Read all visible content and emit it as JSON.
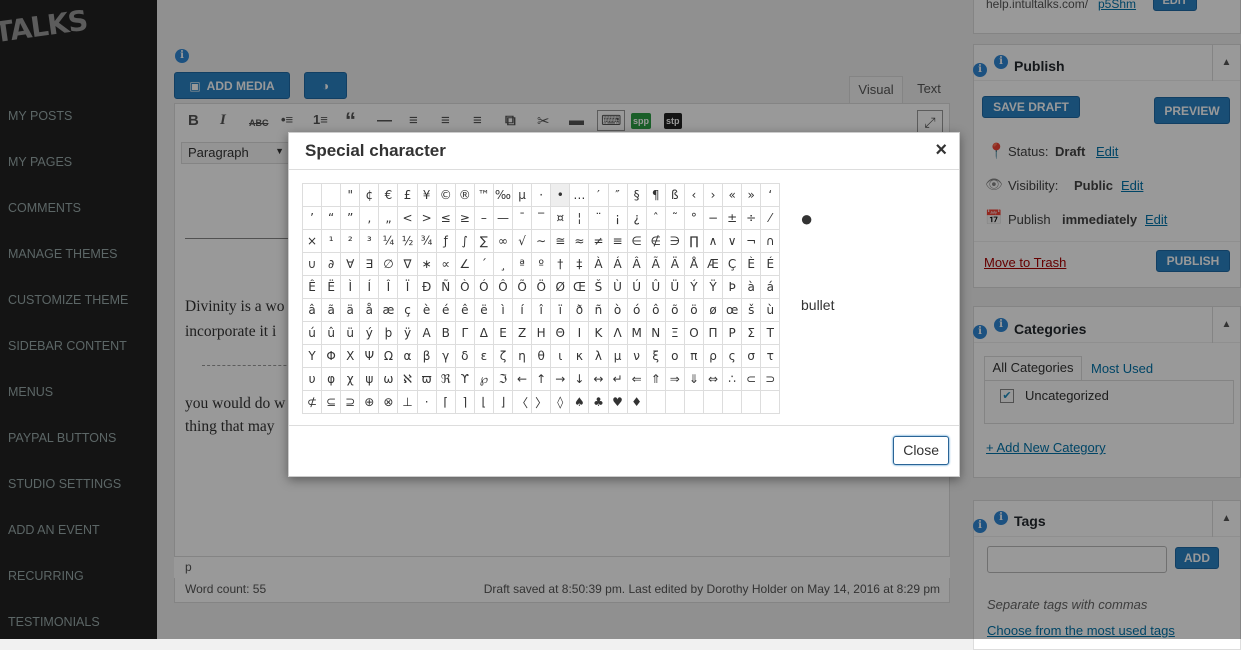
{
  "sidebar": {
    "logo": "TALKS",
    "items": [
      "MY POSTS",
      "MY PAGES",
      "COMMENTS",
      "MANAGE THEMES",
      "CUSTOMIZE THEME",
      "SIDEBAR CONTENT",
      "MENUS",
      "PAYPAL BUTTONS",
      "STUDIO SETTINGS",
      "ADD AN EVENT",
      "RECURRING",
      "TESTIMONIALS"
    ]
  },
  "editor": {
    "add_media": "ADD MEDIA",
    "tab_visual": "Visual",
    "tab_text": "Text",
    "format_select": "Paragraph",
    "toolbar": [
      "B",
      "I",
      "ABC",
      "•≡",
      "1≡",
      "“",
      "—",
      "≡",
      "≡",
      "≡",
      "⧉",
      "✂",
      "▬",
      "⌨",
      "spp",
      "stp"
    ],
    "content_line1": "Divinity is a wo",
    "content_line2": "incorporate it i",
    "content_line3": "you would do w",
    "content_line4": "thing that may",
    "path": "p",
    "word_count": "Word count: 55",
    "draft_status": "Draft saved at 8:50:39 pm. Last edited by Dorothy Holder on May 14, 2016 at 8:29 pm"
  },
  "right": {
    "top_link": "help.intultalks.com/",
    "top_link2": "p5Shm",
    "top_btn": "Edit",
    "publish": {
      "title": "Publish",
      "save_draft": "SAVE DRAFT",
      "preview": "PREVIEW",
      "status_label": "Status:",
      "status_value": "Draft",
      "visibility_label": "Visibility:",
      "visibility_value": "Public",
      "publish_label": "Publish",
      "publish_value": "immediately",
      "edit": "Edit",
      "trash": "Move to Trash",
      "publish_btn": "PUBLISH"
    },
    "categories": {
      "title": "Categories",
      "tab_all": "All Categories",
      "tab_used": "Most Used",
      "item": "Uncategorized",
      "add_new": "+ Add New Category"
    },
    "tags": {
      "title": "Tags",
      "add_btn": "ADD",
      "hint": "Separate tags with commas",
      "choose": "Choose from the most used tags"
    }
  },
  "dialog": {
    "title": "Special character",
    "close_x": "×",
    "preview_char": "●",
    "preview_name": "bullet",
    "close_btn": "Close",
    "rows": [
      [
        "",
        "",
        "\"",
        "¢",
        "€",
        "£",
        "¥",
        "©",
        "®",
        "™",
        "‰",
        "µ",
        "·",
        "•",
        "…",
        "′",
        "″",
        "§",
        "¶",
        "ß",
        "‹",
        "›",
        "«",
        "»",
        "‘"
      ],
      [
        "’",
        "“",
        "”",
        "‚",
        "„",
        "<",
        ">",
        "≤",
        "≥",
        "–",
        "—",
        "¯",
        "‾",
        "¤",
        "¦",
        "¨",
        "¡",
        "¿",
        "ˆ",
        "˜",
        "°",
        "−",
        "±",
        "÷",
        "⁄"
      ],
      [
        "×",
        "¹",
        "²",
        "³",
        "¼",
        "½",
        "¾",
        "ƒ",
        "∫",
        "∑",
        "∞",
        "√",
        "∼",
        "≅",
        "≈",
        "≠",
        "≡",
        "∈",
        "∉",
        "∋",
        "∏",
        "∧",
        "∨",
        "¬",
        "∩"
      ],
      [
        "∪",
        "∂",
        "∀",
        "∃",
        "∅",
        "∇",
        "∗",
        "∝",
        "∠",
        "´",
        "¸",
        "ª",
        "º",
        "†",
        "‡",
        "À",
        "Á",
        "Â",
        "Ã",
        "Ä",
        "Å",
        "Æ",
        "Ç",
        "È",
        "É"
      ],
      [
        "Ê",
        "Ë",
        "Ì",
        "Í",
        "Î",
        "Ï",
        "Ð",
        "Ñ",
        "Ò",
        "Ó",
        "Ô",
        "Õ",
        "Ö",
        "Ø",
        "Œ",
        "Š",
        "Ù",
        "Ú",
        "Û",
        "Ü",
        "Ý",
        "Ÿ",
        "Þ",
        "à",
        "á"
      ],
      [
        "â",
        "ã",
        "ä",
        "å",
        "æ",
        "ç",
        "è",
        "é",
        "ê",
        "ë",
        "ì",
        "í",
        "î",
        "ï",
        "ð",
        "ñ",
        "ò",
        "ó",
        "ô",
        "õ",
        "ö",
        "ø",
        "œ",
        "š",
        "ù"
      ],
      [
        "ú",
        "û",
        "ü",
        "ý",
        "þ",
        "ÿ",
        "Α",
        "Β",
        "Γ",
        "Δ",
        "Ε",
        "Ζ",
        "Η",
        "Θ",
        "Ι",
        "Κ",
        "Λ",
        "Μ",
        "Ν",
        "Ξ",
        "Ο",
        "Π",
        "Ρ",
        "Σ",
        "Τ"
      ],
      [
        "Υ",
        "Φ",
        "Χ",
        "Ψ",
        "Ω",
        "α",
        "β",
        "γ",
        "δ",
        "ε",
        "ζ",
        "η",
        "θ",
        "ι",
        "κ",
        "λ",
        "μ",
        "ν",
        "ξ",
        "ο",
        "π",
        "ρ",
        "ς",
        "σ",
        "τ"
      ],
      [
        "υ",
        "φ",
        "χ",
        "ψ",
        "ω",
        "ℵ",
        "ϖ",
        "ℜ",
        "ϒ",
        "℘",
        "ℑ",
        "←",
        "↑",
        "→",
        "↓",
        "↔",
        "↵",
        "⇐",
        "⇑",
        "⇒",
        "⇓",
        "⇔",
        "∴",
        "⊂",
        "⊃"
      ],
      [
        "⊄",
        "⊆",
        "⊇",
        "⊕",
        "⊗",
        "⊥",
        "⋅",
        "⌈",
        "⌉",
        "⌊",
        "⌋",
        "〈",
        "〉",
        "◊",
        "♠",
        "♣",
        "♥",
        "♦",
        "",
        "",
        "",
        "",
        "",
        "",
        ""
      ]
    ]
  }
}
